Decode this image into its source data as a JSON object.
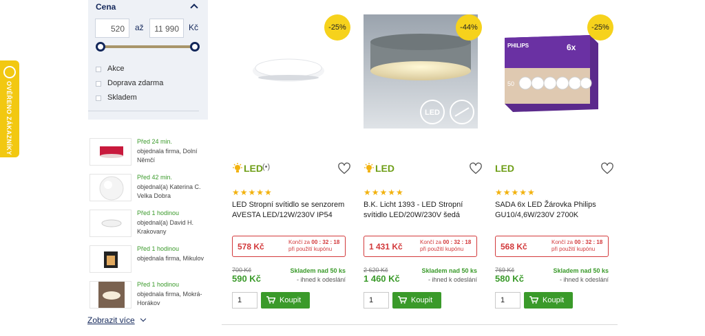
{
  "verified_badge": {
    "label": "OVĚŘENO ZÁKAZNÍKY"
  },
  "filter": {
    "title": "Cena",
    "price_from": "520",
    "separator": "až",
    "price_to": "11 990",
    "currency": "Kč",
    "checkboxes": [
      {
        "label": "Akce",
        "checked": false
      },
      {
        "label": "Doprava zdarma",
        "checked": false
      },
      {
        "label": "Skladem",
        "checked": false
      }
    ]
  },
  "orders": [
    {
      "when": "Před 24 min.",
      "who": "objednala firma, Dolní Němčí"
    },
    {
      "when": "Před 42 min.",
      "who": "objednal(a) Katerina C. Velka Dobra"
    },
    {
      "when": "Před 1 hodinou",
      "who": "objednal(a) David H. Krakovany"
    },
    {
      "when": "Před 1 hodinou",
      "who": "objednala firma, Mikulov"
    },
    {
      "when": "Před 1 hodinou",
      "who": "objednala firma, Mokrá-Horákov"
    }
  ],
  "show_more": "Zobrazit více",
  "products": [
    {
      "discount": "-25%",
      "led": "LED",
      "rating": 4.5,
      "stars": "★★★★★",
      "name": "LED Stropní svítidlo se senzorem AVESTA LED/12W/230V IP54",
      "coupon_price": "578 Kč",
      "coupon_end_label": "Končí za",
      "coupon_timer": "00 : 32 : 18",
      "coupon_note": "při použití kupónu",
      "old_price": "700 Kč",
      "price": "590 Kč",
      "stock": "Skladem nad 50 ks",
      "ship": "- ihned k odeslání",
      "qty": "1",
      "buy": "Koupit"
    },
    {
      "discount": "-44%",
      "led": "LED",
      "rating": 5,
      "stars": "★★★★★",
      "name": "B.K. Licht 1393 - LED Stropní svítidlo LED/20W/230V šedá",
      "coupon_price": "1 431 Kč",
      "coupon_end_label": "Končí za",
      "coupon_timer": "00 : 32 : 18",
      "coupon_note": "při použití kupónu",
      "old_price": "2 620 Kč",
      "price": "1 460 Kč",
      "stock": "Skladem nad 50 ks",
      "ship": "- ihned k odeslání",
      "qty": "1",
      "buy": "Koupit"
    },
    {
      "discount": "-25%",
      "led": "LED",
      "rating": 5,
      "stars": "★★★★★",
      "name": "SADA 6x LED Žárovka Philips GU10/4,6W/230V 2700K",
      "coupon_price": "568 Kč",
      "coupon_end_label": "Končí za",
      "coupon_timer": "00 : 32 : 18",
      "coupon_note": "při použití kupónu",
      "old_price": "769 Kč",
      "price": "580 Kč",
      "stock": "Skladem nad 50 ks",
      "ship": "- ihned k odeslání",
      "qty": "1",
      "buy": "Koupit"
    }
  ],
  "image_labels": {
    "led_logo": "LED",
    "philips_brand": "PHILIPS",
    "pack_count": "6x",
    "pack_watt": "50"
  },
  "colors": {
    "accent_green": "#3a9a2a",
    "coupon_red": "#d2383a",
    "badge_yellow": "#f6d21c",
    "navy": "#13275a"
  }
}
